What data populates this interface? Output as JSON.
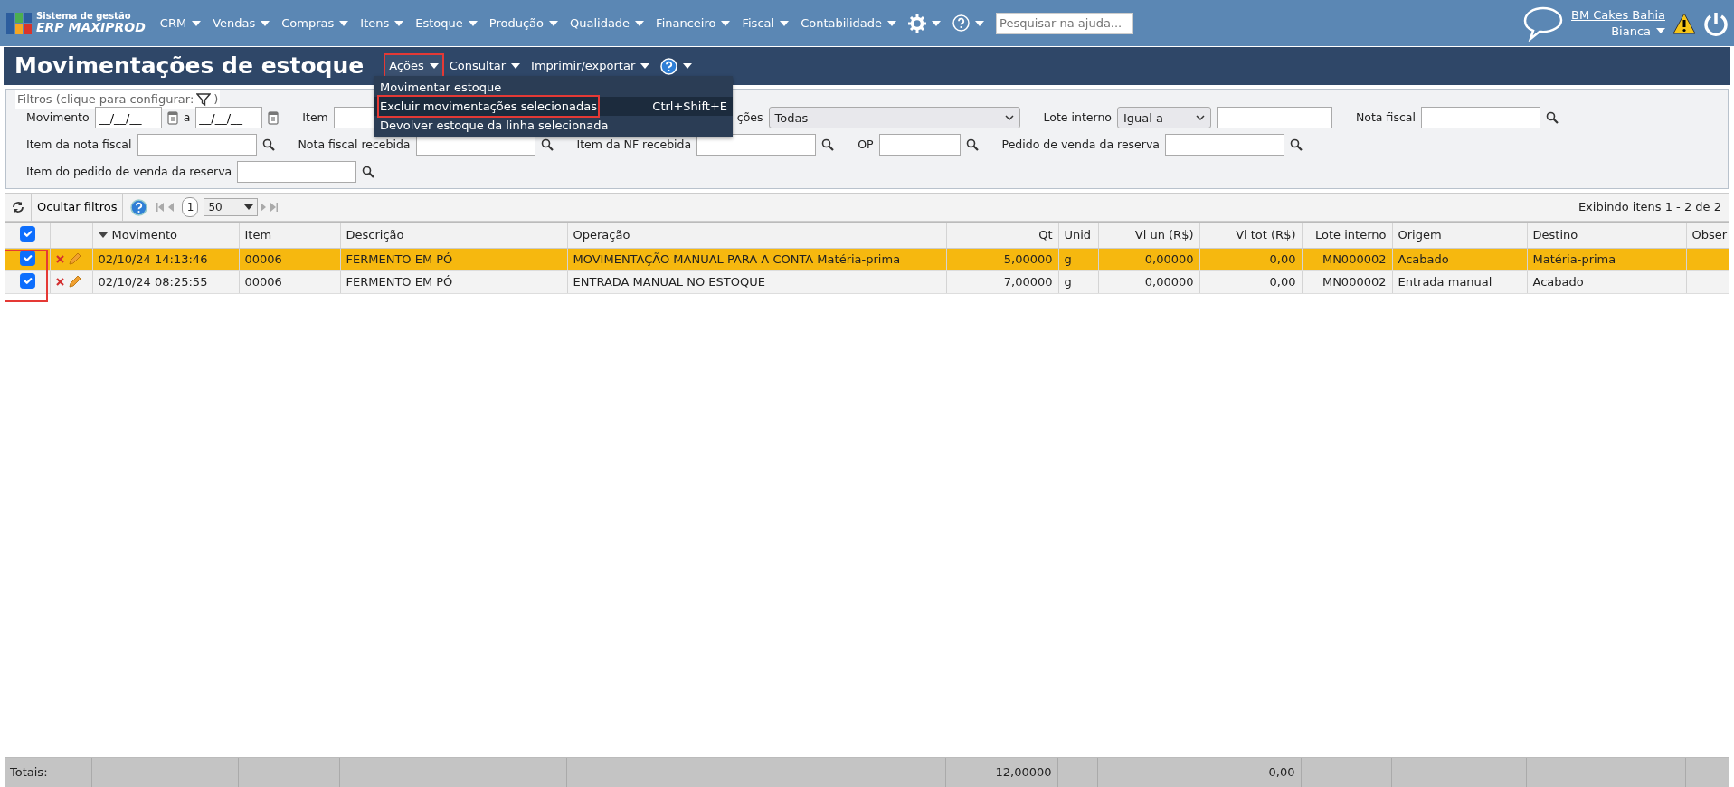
{
  "topnav": {
    "logo_line1": "Sistema de gestão",
    "logo_line2": "ERP MAXIPROD",
    "menus": [
      {
        "label": "CRM"
      },
      {
        "label": "Vendas"
      },
      {
        "label": "Compras"
      },
      {
        "label": "Itens"
      },
      {
        "label": "Estoque"
      },
      {
        "label": "Produção"
      },
      {
        "label": "Qualidade"
      },
      {
        "label": "Financeiro"
      },
      {
        "label": "Fiscal"
      },
      {
        "label": "Contabilidade"
      }
    ],
    "search": {
      "placeholder": "Pesquisar na ajuda..."
    },
    "company": "BM Cakes Bahia",
    "user": "Bianca"
  },
  "page": {
    "title": "Movimentações de estoque",
    "menus": [
      {
        "label": "Ações",
        "open": true,
        "highlighted": true
      },
      {
        "label": "Consultar",
        "open": false,
        "highlighted": false
      },
      {
        "label": "Imprimir/exportar",
        "open": false,
        "highlighted": false
      }
    ],
    "actions_menu": [
      {
        "label": "Movimentar estoque",
        "selected": false,
        "highlighted": false
      },
      {
        "label": "Excluir movimentações selecionadas",
        "shortcut": "Ctrl+Shift+E",
        "selected": true,
        "highlighted": true
      },
      {
        "label": "Devolver estoque da linha selecionada",
        "selected": false,
        "highlighted": false
      }
    ]
  },
  "filters": {
    "legend": "Filtros (clique para configurar:",
    "legend_end": ")",
    "lines": [
      {
        "fields": [
          {
            "kind": "date-range",
            "label": "Movimento",
            "value": "__/__/__",
            "separator": "a",
            "value_to": "__/__/__"
          },
          {
            "kind": "wide",
            "label": "Item"
          },
          {
            "kind": "select-wide",
            "label": "ções",
            "value": "Todas"
          },
          {
            "kind": "select-input",
            "label": "Lote interno",
            "value": "Igual a"
          },
          {
            "kind": "lookup",
            "label": "Nota fiscal"
          }
        ]
      },
      {
        "fields": [
          {
            "kind": "lookup",
            "label": "Item da nota fiscal"
          },
          {
            "kind": "lookup",
            "label": "Nota fiscal recebida"
          },
          {
            "kind": "lookup",
            "label": "Item da NF recebida"
          },
          {
            "kind": "lookup-short",
            "label": "OP"
          },
          {
            "kind": "lookup",
            "label": "Pedido de venda da reserva"
          }
        ]
      },
      {
        "fields": [
          {
            "kind": "lookup",
            "label": "Item do pedido de venda da reserva"
          }
        ]
      }
    ]
  },
  "toolbar": {
    "hide_filters": "Ocultar filtros",
    "page": "1",
    "page_size": "50",
    "summary": "Exibindo itens 1 - 2 de 2"
  },
  "table": {
    "checkbox_column_highlighted": true,
    "all_checked": true,
    "columns": [
      {
        "label": "Movimento",
        "kind": "text",
        "sorted": true
      },
      {
        "label": "Item",
        "kind": "text",
        "sorted": false
      },
      {
        "label": "Descrição",
        "kind": "text",
        "sorted": false
      },
      {
        "label": "Operação",
        "kind": "text",
        "sorted": false
      },
      {
        "label": "Qt",
        "kind": "number",
        "sorted": false,
        "total": "12,00000"
      },
      {
        "label": "Unid",
        "kind": "text",
        "sorted": false
      },
      {
        "label": "Vl un (R$)",
        "kind": "number",
        "sorted": false
      },
      {
        "label": "Vl tot (R$)",
        "kind": "number",
        "sorted": false,
        "total": "0,00"
      },
      {
        "label": "Lote interno",
        "kind": "number",
        "sorted": false
      },
      {
        "label": "Origem",
        "kind": "text",
        "sorted": false
      },
      {
        "label": "Destino",
        "kind": "text",
        "sorted": false
      },
      {
        "label": "Obser",
        "kind": "text",
        "sorted": false
      }
    ],
    "rows": [
      {
        "selected": true,
        "checked": true,
        "cells": [
          "02/10/24 14:13:46",
          "00006",
          "FERMENTO EM PÓ",
          "MOVIMENTAÇÃO MANUAL PARA A CONTA Matéria-prima",
          "5,00000",
          "g",
          "0,00000",
          "0,00",
          "MN000002",
          "Acabado",
          "Matéria-prima",
          ""
        ]
      },
      {
        "selected": false,
        "checked": true,
        "cells": [
          "02/10/24 08:25:55",
          "00006",
          "FERMENTO EM PÓ",
          "ENTRADA MANUAL NO ESTOQUE",
          "7,00000",
          "g",
          "0,00000",
          "0,00",
          "MN000002",
          "Entrada manual",
          "Acabado",
          ""
        ]
      }
    ],
    "totals_label": "Totais:"
  }
}
